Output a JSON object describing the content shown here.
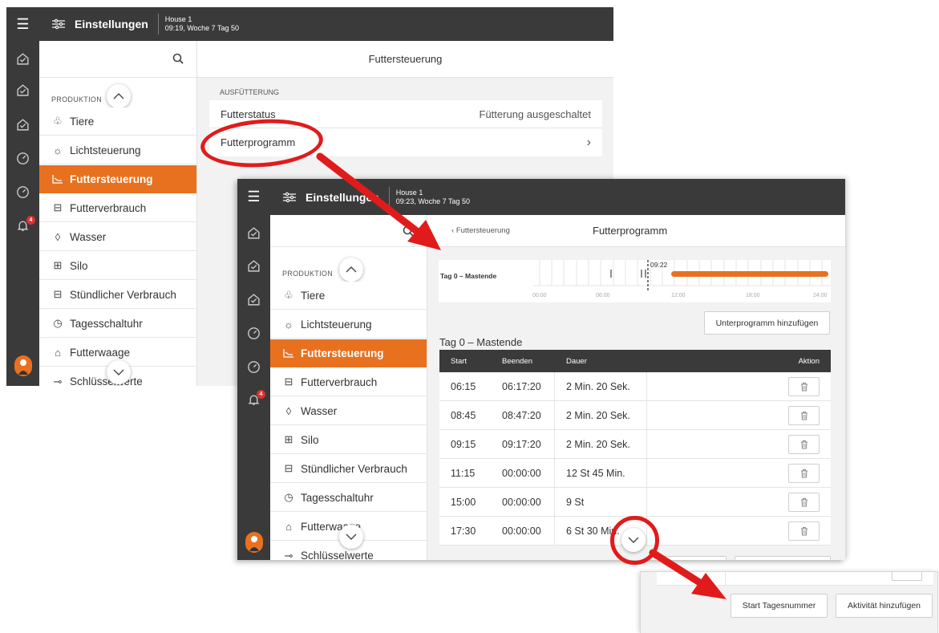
{
  "window1": {
    "title": "Einstellungen",
    "house_name": "House 1",
    "house_time": "09:19, Woche 7 Tag 50",
    "content_title": "Futtersteuerung",
    "section_label": "AUSFÜTTERUNG",
    "rows": [
      {
        "label": "Futterstatus",
        "value": "Fütterung ausgeschaltet"
      },
      {
        "label": "Futterprogramm",
        "value": "›"
      }
    ]
  },
  "window2": {
    "title": "Einstellungen",
    "house_name": "House 1",
    "house_time": "09:23, Woche 7 Tag 50",
    "back_link": "Futtersteuerung",
    "content_title": "Futterprogramm",
    "timeline_label": "Tag 0 – Mastende",
    "timeline_now": "09:22",
    "timeline_ticks": [
      "00:00",
      "06:00",
      "12:00",
      "18:00",
      "24:00"
    ],
    "add_subprogram_button": "Unterprogramm hinzufügen",
    "table_title": "Tag 0 – Mastende",
    "table_headers": [
      "Start",
      "Beenden",
      "Dauer",
      "Aktion"
    ],
    "table_rows": [
      {
        "start": "06:15",
        "end": "06:17:20",
        "duration": "2 Min. 20 Sek."
      },
      {
        "start": "08:45",
        "end": "08:47:20",
        "duration": "2 Min. 20 Sek."
      },
      {
        "start": "09:15",
        "end": "09:17:20",
        "duration": "2 Min. 20 Sek."
      },
      {
        "start": "11:15",
        "end": "00:00:00",
        "duration": "12 St 45 Min."
      },
      {
        "start": "15:00",
        "end": "00:00:00",
        "duration": "9 St"
      },
      {
        "start": "17:30",
        "end": "00:00:00",
        "duration": "6 St 30 Min."
      }
    ]
  },
  "sidebar": {
    "group_label": "PRODUKTION",
    "items": [
      {
        "label": "Tiere",
        "icon": "chicken-icon"
      },
      {
        "label": "Lichtsteuerung",
        "icon": "bulb-icon"
      },
      {
        "label": "Futtersteuerung",
        "icon": "feed-chart-icon"
      },
      {
        "label": "Futterverbrauch",
        "icon": "scale-icon"
      },
      {
        "label": "Wasser",
        "icon": "drop-icon"
      },
      {
        "label": "Silo",
        "icon": "silo-icon"
      },
      {
        "label": "Stündlicher Verbrauch",
        "icon": "scale-icon"
      },
      {
        "label": "Tagesschaltuhr",
        "icon": "clock-icon"
      },
      {
        "label": "Futterwaage",
        "icon": "weigher-icon"
      },
      {
        "label": "Schlüsselwerte",
        "icon": "key-icon"
      }
    ],
    "notification_count": "4"
  },
  "zoom_panel": {
    "start_day_button": "Start Tagesnummer",
    "add_activity_button": "Aktivität hinzufügen"
  },
  "colors": {
    "accent": "#e8711f",
    "dark": "#3a3a3a",
    "annotation": "#e11b1b"
  }
}
